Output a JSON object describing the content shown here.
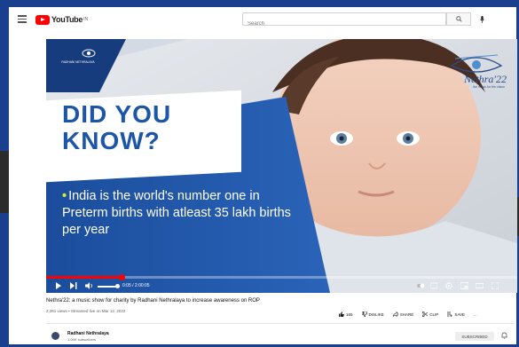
{
  "header": {
    "logo_text": "YouTube",
    "country_code": "IN",
    "search_placeholder": "Search"
  },
  "video": {
    "channel_logo_text": "RADHANI NETHRALAYA",
    "brand_name": "Nethra'22",
    "brand_tagline": "the music for the vision",
    "headline_line1": "DID YOU",
    "headline_line2": "KNOW?",
    "fact_text": "India is the world's number one in Preterm births with atleast 35 lakh births per year",
    "time_display": "0:05 / 2:00:05",
    "progress_fraction": 0.16,
    "volume_fraction": 0.8
  },
  "info": {
    "title": "Nethra'22: a music show for charity by Radhani Nethralaya to increase awareness on ROP",
    "meta": "2,391 views • Streamed live on Mar 12, 2022",
    "like_count": "165",
    "dislike_label": "DISLIKE",
    "share_label": "SHARE",
    "clip_label": "CLIP",
    "save_label": "SAVE",
    "more_label": "..."
  },
  "channel": {
    "name": "Radhani Nethralaya",
    "subscribers": "1.04K subscribers",
    "subscribe_label": "SUBSCRIBED"
  },
  "colors": {
    "frame": "#1a3f8f",
    "accent_blue": "#1d56a8",
    "progress_red": "#ff0000",
    "bullet_yellow": "#d9e93a"
  }
}
